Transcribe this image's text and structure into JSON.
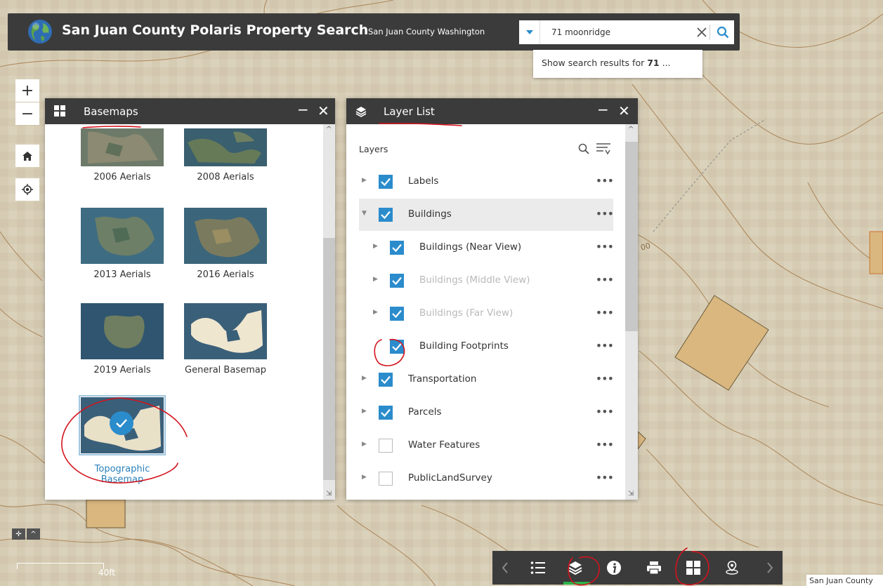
{
  "header": {
    "title": "San Juan County Polaris Property Search",
    "subtitle": "San Juan County Washington"
  },
  "search": {
    "value": "71 moonridge",
    "suggestion_prefix": "Show search results for ",
    "suggestion_bold": "71",
    "suggestion_suffix": " ..."
  },
  "map_controls": {
    "zoom_in": "+",
    "zoom_out": "−"
  },
  "basemaps": {
    "title": "Basemaps",
    "minimize": "−",
    "close": "✕",
    "items": [
      {
        "label": "2006 Aerials"
      },
      {
        "label": "2008 Aerials"
      },
      {
        "label": "2013 Aerials"
      },
      {
        "label": "2016 Aerials"
      },
      {
        "label": "2019 Aerials"
      },
      {
        "label": "General Basemap"
      },
      {
        "label": "Topographic Basemap",
        "selected": true
      }
    ]
  },
  "layer_list": {
    "title": "Layer List",
    "minimize": "−",
    "close": "✕",
    "layers_label": "Layers",
    "more_label": "•••",
    "rows": [
      {
        "label": "Labels",
        "checked": true,
        "expanded": false,
        "indent": 0,
        "dim": false
      },
      {
        "label": "Buildings",
        "checked": true,
        "expanded": true,
        "indent": 0,
        "dim": false
      },
      {
        "label": "Buildings (Near View)",
        "checked": true,
        "expanded": false,
        "indent": 1,
        "dim": false
      },
      {
        "label": "Buildings (Middle View)",
        "checked": true,
        "expanded": false,
        "indent": 1,
        "dim": true
      },
      {
        "label": "Buildings (Far View)",
        "checked": true,
        "expanded": false,
        "indent": 1,
        "dim": true
      },
      {
        "label": "Building Footprints",
        "checked": true,
        "expanded": false,
        "indent": 1,
        "dim": false,
        "no_arrow": true
      },
      {
        "label": "Transportation",
        "checked": true,
        "expanded": false,
        "indent": 0,
        "dim": false
      },
      {
        "label": "Parcels",
        "checked": true,
        "expanded": false,
        "indent": 0,
        "dim": false
      },
      {
        "label": "Water Features",
        "checked": false,
        "expanded": false,
        "indent": 0,
        "dim": false
      },
      {
        "label": "PublicLandSurvey",
        "checked": false,
        "expanded": false,
        "indent": 0,
        "dim": false
      }
    ]
  },
  "map": {
    "contour_label": "00",
    "scale_label": "40ft",
    "attribution": "San Juan County"
  },
  "colors": {
    "header_bg": "#3b3b3b",
    "accent_blue": "#2b8ccc",
    "active_green": "#2db34a",
    "annotation_red": "#d3141d"
  },
  "toolbar_icons": [
    "legend-icon",
    "layers-icon",
    "info-icon",
    "print-icon",
    "basemap-gallery-icon",
    "location-icon"
  ]
}
